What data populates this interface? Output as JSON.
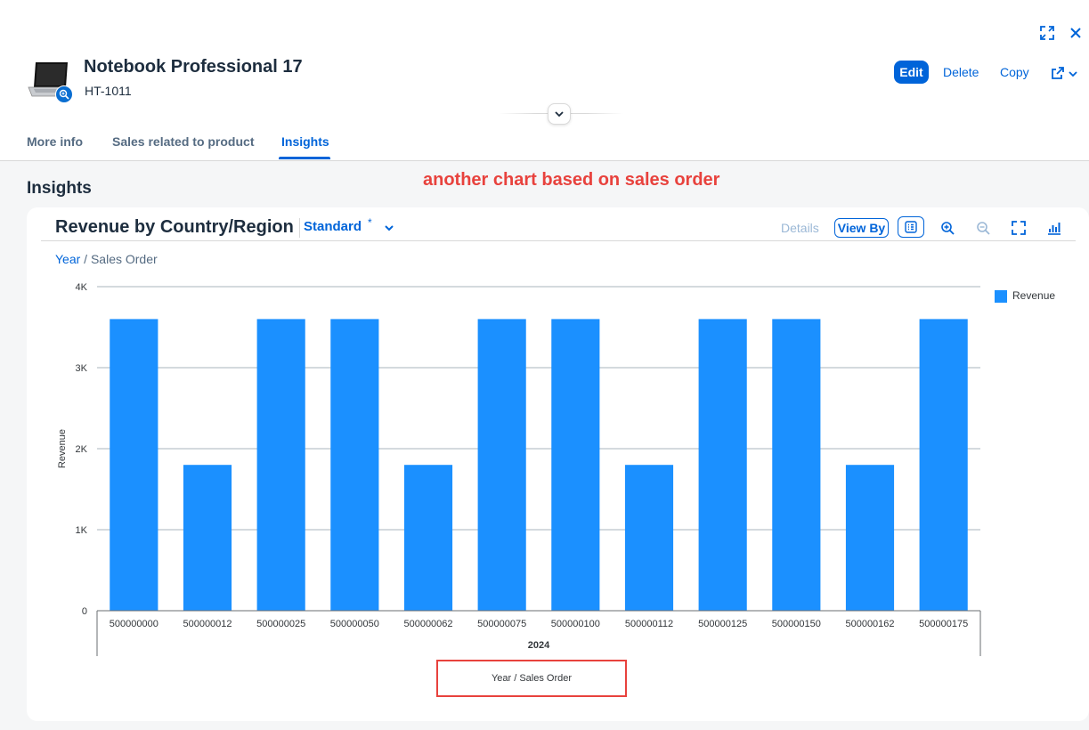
{
  "header": {
    "title": "Notebook Professional 17",
    "subtitle": "HT-1011",
    "actions": {
      "edit": "Edit",
      "delete": "Delete",
      "copy": "Copy"
    },
    "icons": [
      "exit-fullscreen-icon",
      "close-icon",
      "share-icon",
      "chevron-down-icon",
      "zoom-in-icon",
      "collapse-header-icon"
    ]
  },
  "tabs": [
    {
      "label": "More info",
      "active": false
    },
    {
      "label": "Sales related to product",
      "active": false
    },
    {
      "label": "Insights",
      "active": true
    }
  ],
  "section": {
    "title": "Insights"
  },
  "annotation": {
    "text": "another chart based on sales order",
    "color": "#e8423d"
  },
  "chart_card": {
    "title": "Revenue by Country/Region",
    "variant": "Standard",
    "variant_modified_marker": "*",
    "toolbar": {
      "details": "Details",
      "view_by": "View By"
    },
    "breadcrumb": {
      "link": "Year",
      "separator": " / ",
      "current": "Sales Order"
    }
  },
  "chart_data": {
    "type": "bar",
    "categories": [
      "500000000",
      "500000012",
      "500000025",
      "500000050",
      "500000062",
      "500000075",
      "500000100",
      "500000112",
      "500000125",
      "500000150",
      "500000162",
      "500000175"
    ],
    "series": [
      {
        "name": "Revenue",
        "color": "#1b90ff",
        "values": [
          3600,
          1800,
          3600,
          3600,
          1800,
          3600,
          3600,
          1800,
          3600,
          3600,
          1800,
          3600
        ]
      }
    ],
    "group_label": "2024",
    "ylabel": "Revenue",
    "xlabel": "Year / Sales Order",
    "ylim": [
      0,
      4000
    ],
    "yticks": [
      {
        "value": 0,
        "label": "0"
      },
      {
        "value": 1000,
        "label": "1K"
      },
      {
        "value": 2000,
        "label": "2K"
      },
      {
        "value": 3000,
        "label": "3K"
      },
      {
        "value": 4000,
        "label": "4K"
      }
    ],
    "grid": true,
    "legend_position": "top-right"
  },
  "colors": {
    "accent": "#0064d9",
    "bar": "#1b90ff",
    "annotation": "#e8423d"
  }
}
